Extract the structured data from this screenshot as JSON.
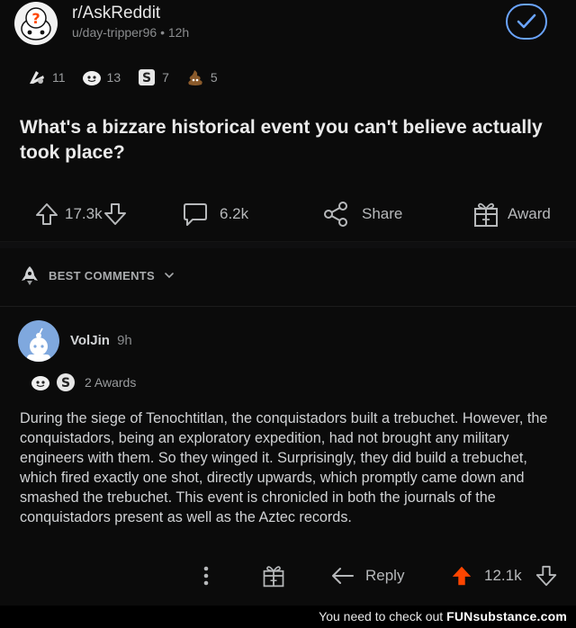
{
  "post": {
    "subreddit": "r/AskReddit",
    "author": "u/day-tripper96",
    "separator": "•",
    "age": "12h",
    "awards": [
      {
        "icon": "silver-award-icon",
        "count": "11"
      },
      {
        "icon": "wholesome-award-icon",
        "count": "13"
      },
      {
        "icon": "s-award-icon",
        "count": "7"
      },
      {
        "icon": "poop-award-icon",
        "count": "5"
      }
    ],
    "title": "What's a bizzare historical event you can't believe actually took place?",
    "upvotes": "17.3k",
    "comments": "6.2k",
    "share_label": "Share",
    "award_label": "Award"
  },
  "sort": {
    "label": "BEST COMMENTS"
  },
  "comment": {
    "username": "VolJin",
    "age": "9h",
    "awards_label": "2 Awards",
    "body": "During the siege of Tenochtitlan, the conquistadors built a trebuchet. However, the conquistadors, being an exploratory expedition, had not brought any military engineers with them. So they winged it. Surprisingly, they did build a trebuchet, which fired exactly one shot, directly upwards, which promptly came down and smashed the trebuchet. This event is chronicled in both the journals of the conquistadors present as well as the Aztec records.",
    "reply_label": "Reply",
    "score": "12.1k"
  },
  "watermark": {
    "prefix": "You need to check out ",
    "brand": "FUNsubstance.com"
  },
  "colors": {
    "background": "#0b0b0b",
    "joined_blue": "#6aa4ff",
    "upvote_orange": "#ff4500"
  }
}
